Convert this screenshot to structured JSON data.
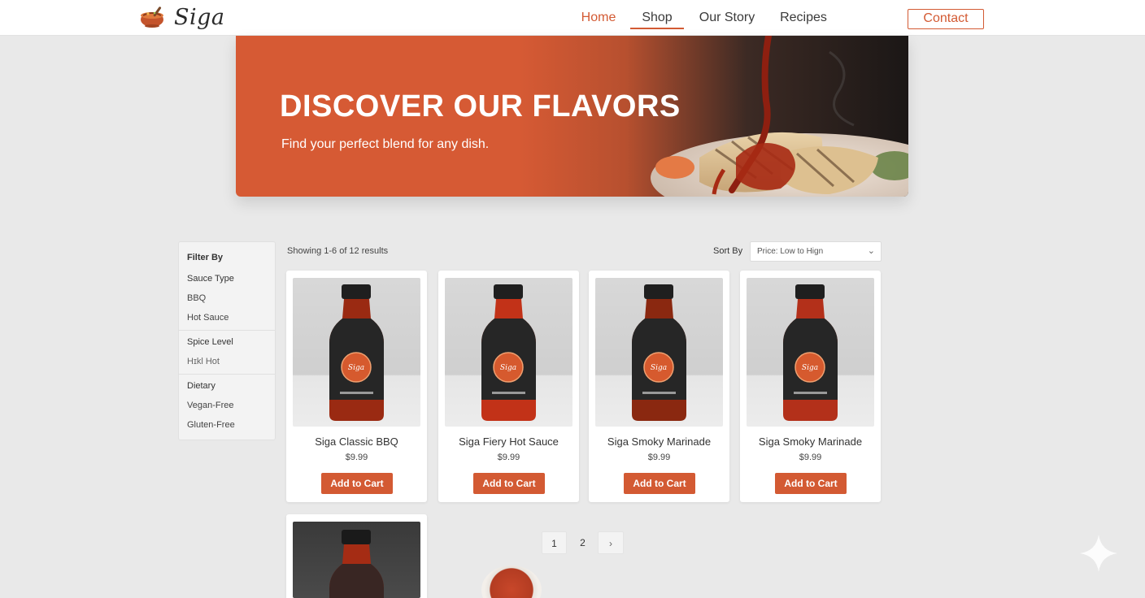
{
  "brand": {
    "name": "Siga"
  },
  "nav": {
    "items": [
      {
        "label": "Home",
        "active": true
      },
      {
        "label": "Shop",
        "selected": true
      },
      {
        "label": "Our Story"
      },
      {
        "label": "Recipes"
      }
    ],
    "contact_label": "Contact"
  },
  "hero": {
    "title": "DISCOVER OUR FLAVORS",
    "subtitle": "Find your perfect blend for any dish."
  },
  "filters": {
    "heading": "Filter By",
    "groups": [
      {
        "title": "Sauce Type",
        "options": [
          "BBQ",
          "Hot Sauce"
        ]
      },
      {
        "title": "Spice Level",
        "options": [
          "Hɪkl Hot"
        ]
      },
      {
        "title": "Dietary",
        "options": [
          "Vegan-Free",
          "Gluten-Free"
        ]
      }
    ]
  },
  "toolbar": {
    "results_text": "Showing 1-6 of 12 results",
    "sort_label": "Sort By",
    "sort_value": "Price: Low to Hign"
  },
  "products": [
    {
      "name": "Siga Classic BBQ",
      "price": "$9.99",
      "button": "Add to Cart"
    },
    {
      "name": "Siga Fiery Hot Sauce",
      "price": "$9.99",
      "button": "Add to Cart"
    },
    {
      "name": "Siga Smoky Marinade",
      "price": "$9.99",
      "button": "Add to Cart"
    },
    {
      "name": "Siga Smoky Marinade",
      "price": "$9.99",
      "button": "Add to Cart"
    }
  ],
  "pagination": {
    "pages": [
      "1",
      "2"
    ],
    "current": "1",
    "next_icon": "chevron-right-icon"
  },
  "colors": {
    "accent": "#d35a33",
    "background": "#e9e9e9",
    "sidebar": "#f3f3f3"
  }
}
